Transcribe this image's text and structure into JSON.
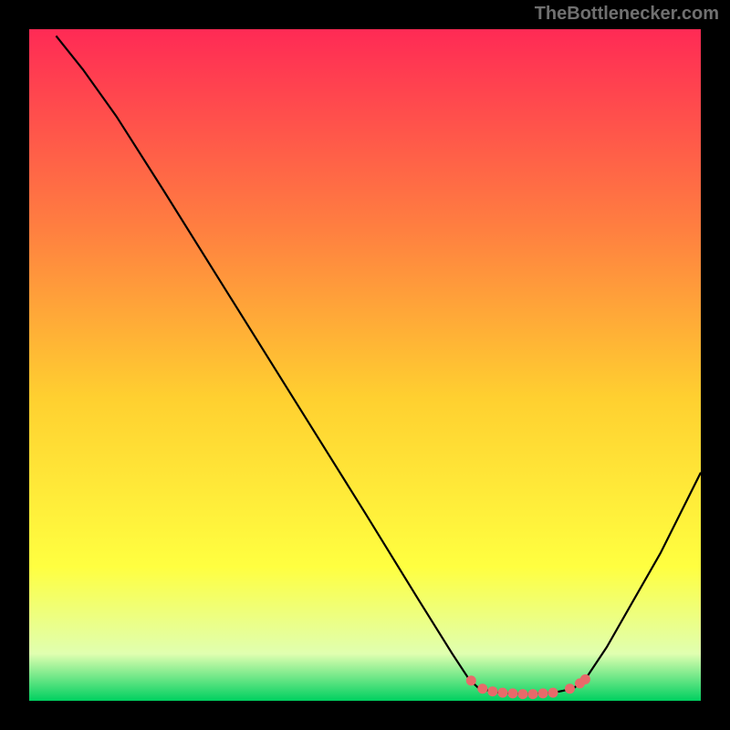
{
  "watermark": "TheBottlenecker.com",
  "chart_data": {
    "type": "line",
    "title": "",
    "xlabel": "",
    "ylabel": "",
    "xlim": [
      0,
      100
    ],
    "ylim": [
      0,
      100
    ],
    "gradient_colors": {
      "top": "#ff2a55",
      "mid1": "#ff8040",
      "mid2": "#ffd030",
      "mid3": "#ffff40",
      "mid4": "#e0ffb0",
      "bottom": "#00d060"
    },
    "curve": [
      {
        "x": 4,
        "y": 99
      },
      {
        "x": 8,
        "y": 94
      },
      {
        "x": 13,
        "y": 87
      },
      {
        "x": 20,
        "y": 76
      },
      {
        "x": 30,
        "y": 60
      },
      {
        "x": 40,
        "y": 44
      },
      {
        "x": 50,
        "y": 28
      },
      {
        "x": 58,
        "y": 15
      },
      {
        "x": 63,
        "y": 7
      },
      {
        "x": 65.5,
        "y": 3.2
      },
      {
        "x": 67,
        "y": 1.8
      },
      {
        "x": 70,
        "y": 1.2
      },
      {
        "x": 74,
        "y": 1.0
      },
      {
        "x": 78,
        "y": 1.2
      },
      {
        "x": 81,
        "y": 1.8
      },
      {
        "x": 83,
        "y": 3.5
      },
      {
        "x": 86,
        "y": 8
      },
      {
        "x": 90,
        "y": 15
      },
      {
        "x": 94,
        "y": 22
      },
      {
        "x": 98,
        "y": 30
      },
      {
        "x": 100,
        "y": 34
      }
    ],
    "markers": [
      {
        "x": 65.8,
        "y": 3.0
      },
      {
        "x": 67.5,
        "y": 1.8
      },
      {
        "x": 69.0,
        "y": 1.4
      },
      {
        "x": 70.5,
        "y": 1.2
      },
      {
        "x": 72.0,
        "y": 1.1
      },
      {
        "x": 73.5,
        "y": 1.0
      },
      {
        "x": 75.0,
        "y": 1.0
      },
      {
        "x": 76.5,
        "y": 1.1
      },
      {
        "x": 78.0,
        "y": 1.2
      },
      {
        "x": 80.5,
        "y": 1.8
      },
      {
        "x": 82.0,
        "y": 2.6
      },
      {
        "x": 82.8,
        "y": 3.2
      }
    ],
    "marker_color": "#e86a6a"
  }
}
